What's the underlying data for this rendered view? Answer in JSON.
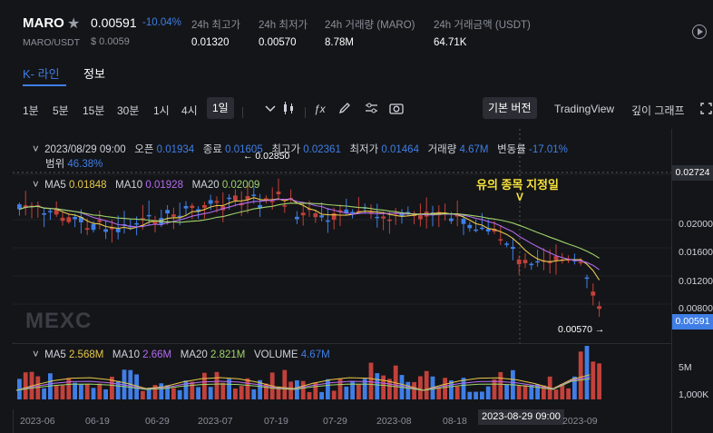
{
  "ticker": {
    "symbol": "MARO",
    "pair": "MARO/USDT",
    "price": "0.00591",
    "change_pct": "-10.04%",
    "usd_price": "$ 0.0059",
    "stats": [
      {
        "label": "24h 최고가",
        "value": "0.01320"
      },
      {
        "label": "24h 최저가",
        "value": "0.00570"
      },
      {
        "label": "24h 거래량 (MARO)",
        "value": "8.78M"
      },
      {
        "label": "24h 거래금액 (USDT)",
        "value": "64.71K"
      }
    ]
  },
  "tabs": [
    {
      "label": "K- 라인",
      "active": true
    },
    {
      "label": "정보",
      "active": false
    }
  ],
  "toolbar": {
    "intervals": [
      "1분",
      "5분",
      "15분",
      "30분",
      "1시",
      "4시",
      "1일"
    ],
    "selected": "1일",
    "version_basic": "기본 버전",
    "tradingview": "TradingView",
    "depth": "깊이 그래프"
  },
  "ohlc": {
    "date": "2023/08/29 09:00",
    "open_label": "오픈",
    "open": "0.01934",
    "close_label": "종료",
    "close": "0.01605",
    "high_label": "최고가",
    "high": "0.02361",
    "low_label": "최저가",
    "low": "0.01464",
    "volume_label": "거래량",
    "volume": "4.67M",
    "change_label": "변동률",
    "change": "-17.01%",
    "range_label": "범위",
    "range": "46.38%"
  },
  "ma": {
    "ma5_label": "MA5",
    "ma5": "0.01848",
    "ma10_label": "MA10",
    "ma10": "0.01928",
    "ma20_label": "MA20",
    "ma20": "0.02009"
  },
  "vol_ma": {
    "ma5_label": "MA5",
    "ma5": "2.568M",
    "ma10_label": "MA10",
    "ma10": "2.66M",
    "ma20_label": "MA20",
    "ma20": "2.821M",
    "volume_label": "VOLUME",
    "volume": "4.67M"
  },
  "annotation": {
    "text": "유의 종목 지정일",
    "arrow": "V"
  },
  "high_marker": "0.02850",
  "low_marker": "0.00570",
  "y_axis": [
    "0.02724",
    "0.02000",
    "0.01600",
    "0.01200",
    "0.00800"
  ],
  "current_price_tag": "0.00591",
  "vol_axis": [
    "5M",
    "1,000K"
  ],
  "x_axis": [
    "2023-06",
    "06-19",
    "06-29",
    "2023-07",
    "07-19",
    "07-29",
    "2023-08",
    "08-18",
    "2023-08-29 09:00",
    "2023-09"
  ],
  "watermark": "MEXC",
  "colors": {
    "up": "#c2413b",
    "down": "#3f7ee6",
    "ma5": "#e6c84b",
    "ma10": "#b36bf0",
    "ma20": "#9ed36a"
  }
}
